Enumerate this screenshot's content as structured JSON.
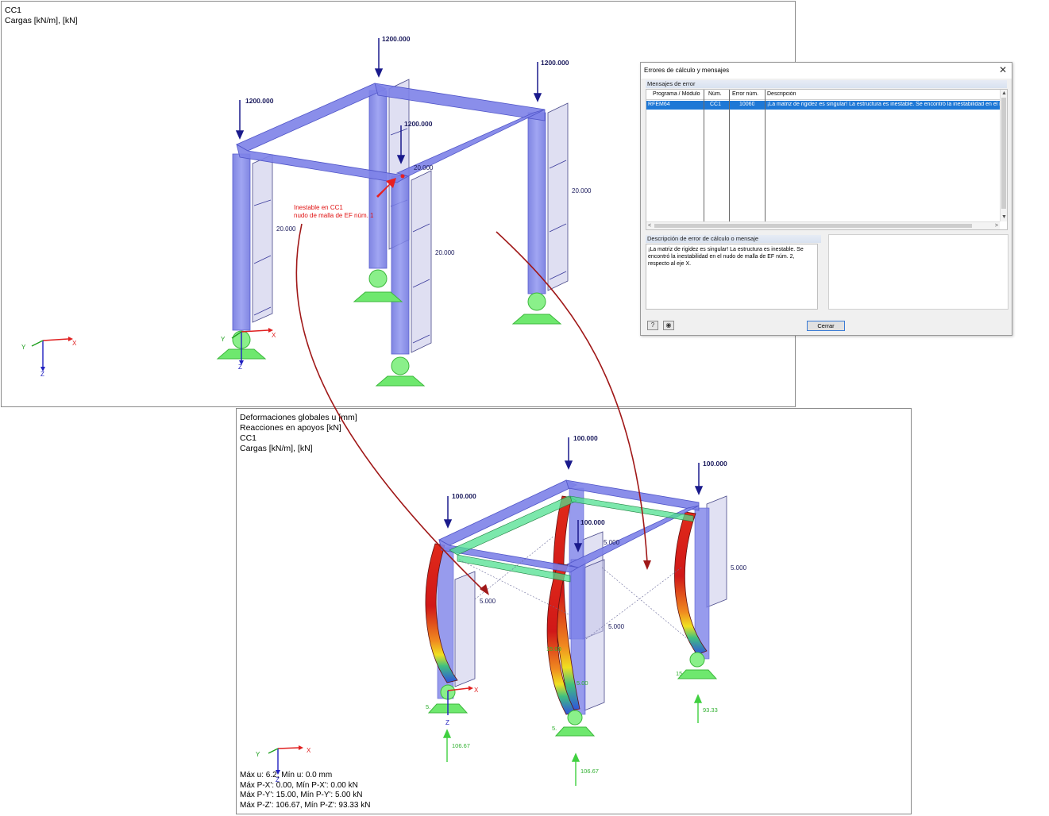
{
  "top_view": {
    "header": [
      "CC1",
      "Cargas [kN/m], [kN]"
    ],
    "point_loads": [
      "1200.000",
      "1200.000",
      "1200.000",
      "1200.000"
    ],
    "line_loads": [
      "20.000",
      "20.000",
      "20.000",
      "20.000"
    ],
    "error_label_line1": "Inestable en CC1",
    "error_label_line2": "nudo de malla de EF núm. 1",
    "axes": {
      "x": "X",
      "y": "Y",
      "z": "Z"
    }
  },
  "bottom_view": {
    "header": [
      "Deformaciones globales u [mm]",
      "Reacciones en apoyos [kN]",
      "CC1",
      "Cargas [kN/m], [kN]"
    ],
    "point_loads": [
      "100.000",
      "100.000",
      "100.000",
      "100.000"
    ],
    "line_loads": [
      "5.000",
      "5.000",
      "5.000",
      "5.000"
    ],
    "reactions": [
      "106.67",
      "106.67",
      "93.33"
    ],
    "small_labels": [
      "15.00",
      "5.00",
      "5.",
      "15",
      "5."
    ],
    "axes": {
      "x": "X",
      "y": "Y",
      "z": "Z"
    },
    "footer": [
      "Máx u: 6.2, Mín u: 0.0 mm",
      "Máx P-X': 0.00, Mín P-X': 0.00 kN",
      "Máx P-Y': 15.00, Mín P-Y': 5.00 kN",
      "Máx P-Z': 106.67, Mín P-Z': 93.33 kN"
    ]
  },
  "dialog": {
    "title": "Errores de cálculo y mensajes",
    "close_glyph": "✕",
    "section_messages": "Mensajes de error",
    "columns": [
      "Programa / Módulo",
      "Núm.",
      "Error núm.",
      "Descripción"
    ],
    "row": {
      "program": "RFEM64",
      "num": "CC1",
      "error": "10060",
      "description": "¡La matriz de rigidez es singular! La estructura es inestable. Se encontró la inestabilidad en el nudo"
    },
    "section_description": "Descripción de error de cálculo o mensaje",
    "description_text": "¡La matriz de rigidez es singular! La estructura es inestable. Se encontró la inestabilidad en el nudo de malla de EF núm. 2, respecto al eje X.",
    "help_icon": "?",
    "view_icon": "◉",
    "close_button": "Cerrar",
    "scroll_up": "▲",
    "scroll_down": "▼",
    "scroll_left": "<",
    "scroll_right": ">"
  },
  "colors": {
    "member": "#7b80e6",
    "load": "#1a1a8c",
    "support": "#6ee86e",
    "error_text": "#e01010",
    "pointer_arrow": "#a01818",
    "selection": "#1e78d6"
  }
}
